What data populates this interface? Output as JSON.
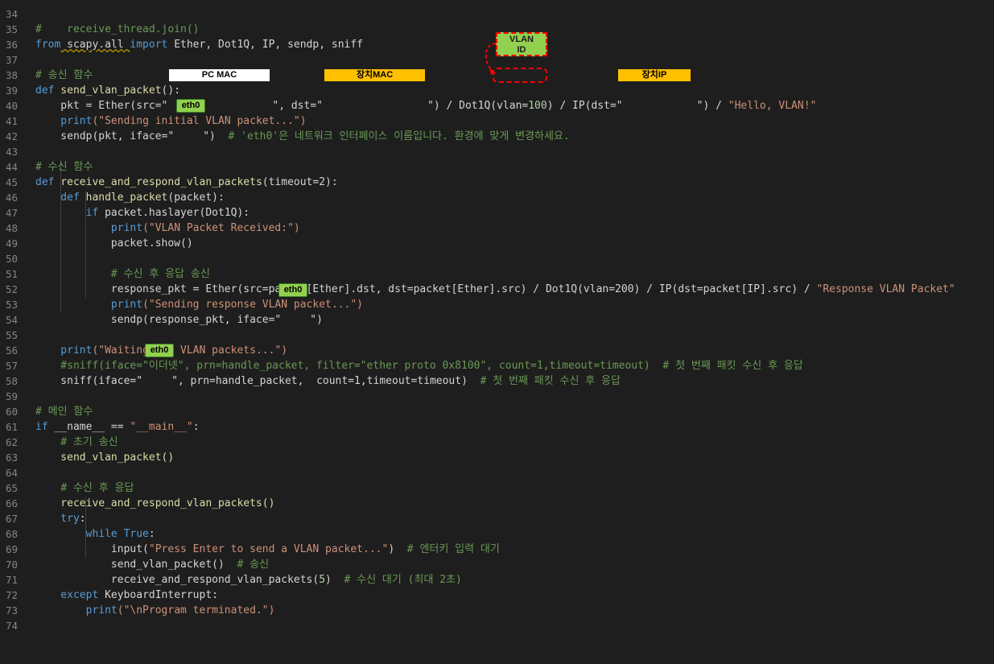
{
  "line_numbers": [
    "34",
    "35",
    "36",
    "37",
    "38",
    "39",
    "40",
    "41",
    "42",
    "43",
    "44",
    "45",
    "46",
    "47",
    "48",
    "49",
    "50",
    "51",
    "52",
    "53",
    "54",
    "55",
    "56",
    "57",
    "58",
    "59",
    "60",
    "61",
    "62",
    "63",
    "64",
    "65",
    "66",
    "67",
    "68",
    "69",
    "70",
    "71",
    "72",
    "73",
    "74"
  ],
  "code": {
    "l34": "#    receive_thread.join()",
    "l35_from": "from",
    "l35_mod": " scapy.all ",
    "l35_import": "import",
    "l35_rest": " Ether, Dot1Q, IP, sendp, sniff",
    "l37": "# 송신 함수",
    "l38_def": "def",
    "l38_fn": " send_vlan_packet",
    "l38_rest": "():",
    "l39_a": "    pkt = Ether(src=\"",
    "l39_b": "\", dst=\"",
    "l39_c": "\") / Dot1Q(vlan=",
    "l39_vlan": "100",
    "l39_d": ") / IP(dst=\"",
    "l39_e": "\") / ",
    "l39_str": "\"Hello, VLAN!\"",
    "l40_print": "    print",
    "l40_str": "(\"Sending initial VLAN packet...\")",
    "l41_a": "    sendp(pkt, iface=\"",
    "l41_b": "\")  ",
    "l41_cm": "# 'eth0'은 네트워크 인터페이스 이름입니다. 환경에 맞게 변경하세요.",
    "l43": "# 수신 함수",
    "l44_def": "def",
    "l44_fn": " receive_and_respond_vlan_packets",
    "l44_rest": "(timeout=2):",
    "l45_def": "    def",
    "l45_fn": " handle_packet",
    "l45_rest": "(packet):",
    "l46_if": "        if",
    "l46_rest": " packet.haslayer(Dot1Q):",
    "l47_print": "            print",
    "l47_str": "(\"VLAN Packet Received:\")",
    "l48": "            packet.show()",
    "l50": "            # 수신 후 응답 송신",
    "l51_a": "            response_pkt = Ether(src=packet[Ether].dst, dst=packet[Ether].src) / Dot1Q(vlan=200) / IP(dst=packet[IP].src) / ",
    "l51_str": "\"Response VLAN Packet\"",
    "l52_print": "            print",
    "l52_str": "(\"Sending response VLAN packet...\")",
    "l53_a": "            sendp(response_pkt, iface=\"",
    "l53_b": "\")",
    "l55_print": "    print",
    "l55_str": "(\"Waiting for VLAN packets...\")",
    "l56": "    #sniff(iface=\"이더넷\", prn=handle_packet, filter=\"ether proto 0x8100\", count=1,timeout=timeout)  # 첫 번째 패킷 수신 후 응답",
    "l57_a": "    sniff(iface=\"",
    "l57_b": "\", prn=handle_packet,  count=1,timeout=timeout)  ",
    "l57_cm": "# 첫 번째 패킷 수신 후 응답",
    "l59": "# 메인 함수",
    "l60_if": "if",
    "l60_a": " __name__ == ",
    "l60_str": "\"__main__\"",
    "l60_b": ":",
    "l61": "    # 초기 송신",
    "l62": "    send_vlan_packet()",
    "l64": "    # 수신 후 응답",
    "l65": "    receive_and_respond_vlan_packets()",
    "l66_try": "    try",
    "l66_b": ":",
    "l67_while": "        while",
    "l67_true": " True",
    "l67_b": ":",
    "l68_a": "            input(",
    "l68_str": "\"Press Enter to send a VLAN packet...\"",
    "l68_b": ")  ",
    "l68_cm": "# 엔터키 입력 대기",
    "l69_a": "            send_vlan_packet()  ",
    "l69_cm": "# 송신",
    "l70_a": "            receive_and_respond_vlan_packets(",
    "l70_num": "5",
    "l70_b": ")  ",
    "l70_cm": "# 수신 대기 (최대 2초)",
    "l71_except": "    except",
    "l71_b": " KeyboardInterrupt:",
    "l72_print": "        print",
    "l72_str": "(\"\\nProgram terminated.\")",
    "l73": "    ",
    "l74": "    "
  },
  "masks": {
    "pc_mac": "PC MAC",
    "device_mac": "장치MAC",
    "device_ip": "장치IP",
    "eth0": "eth0"
  },
  "callout": {
    "line1": "VLAN",
    "line2": "ID"
  },
  "colors": {
    "background": "#1e1e1e",
    "keyword": "#569cd6",
    "function": "#dcdcaa",
    "string": "#ce9178",
    "comment": "#6a9955",
    "mask_white": "#ffffff",
    "mask_orange": "#ffc000",
    "mask_green": "#92d050",
    "annotation_red": "#ff0000"
  }
}
